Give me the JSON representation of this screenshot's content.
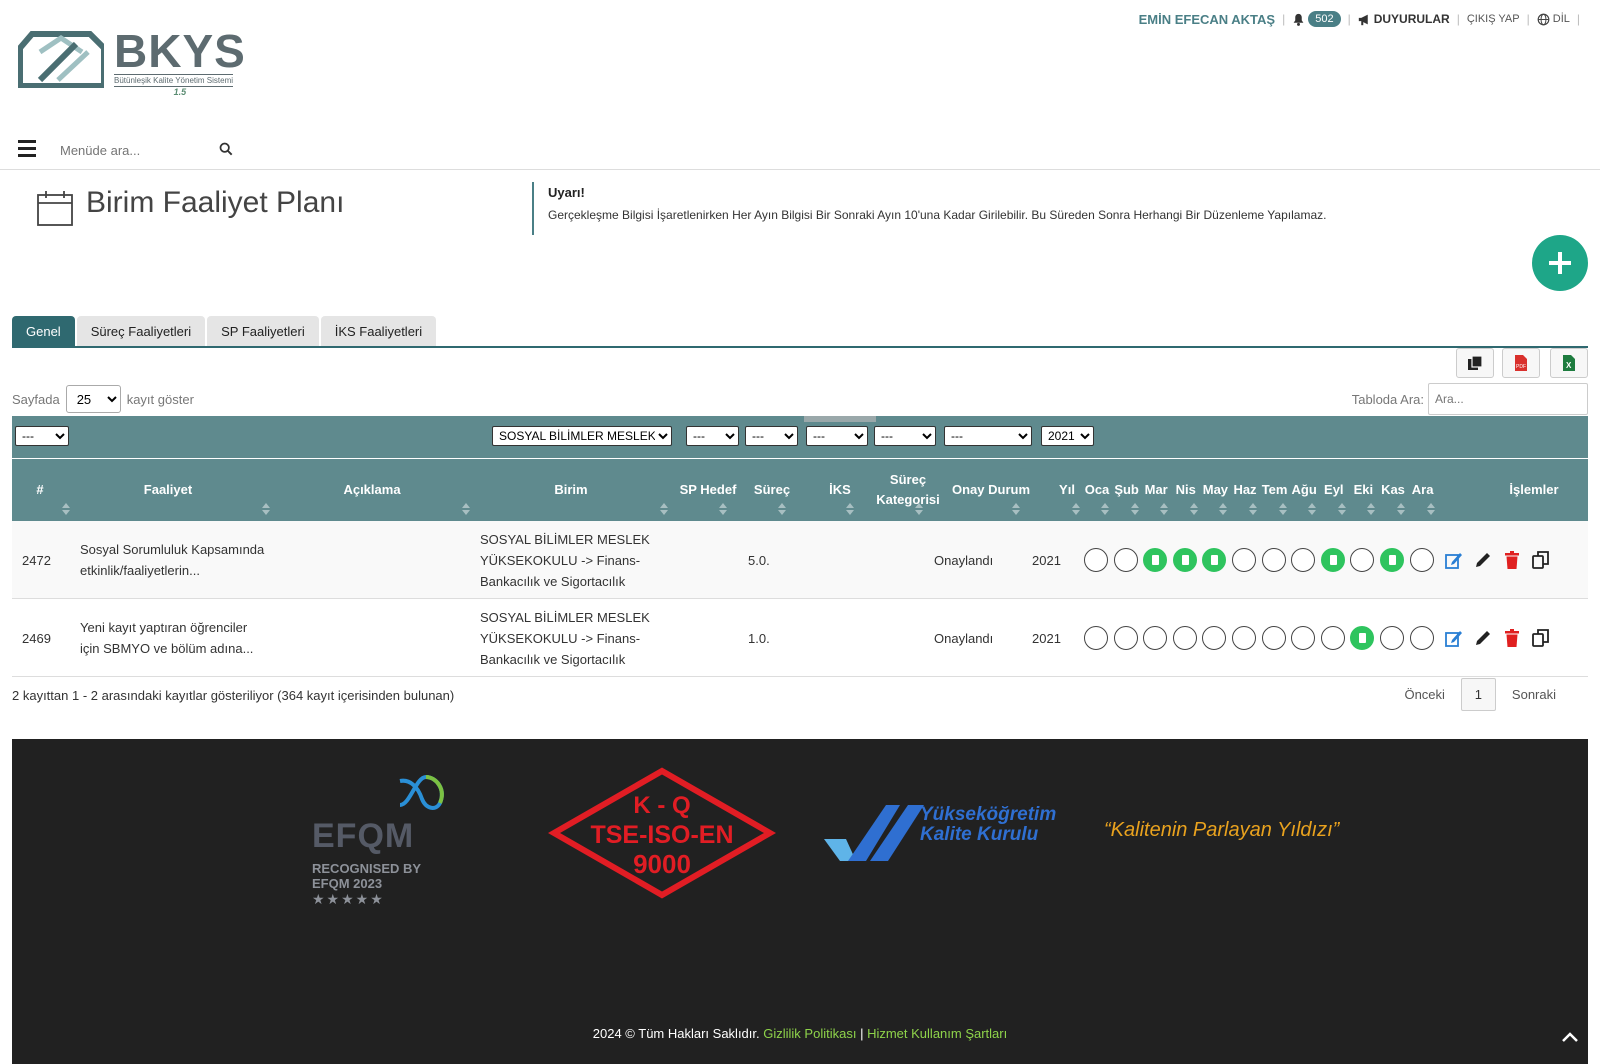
{
  "app": {
    "logo_word": "BKYS",
    "logo_subtitle": "Bütünleşik Kalite Yönetim Sistemi",
    "logo_version": "1.5"
  },
  "topbar": {
    "user_name": "EMİN EFECAN  AKTAŞ",
    "notification_count": "502",
    "announcements_label": "DUYURULAR",
    "logout_label": "ÇIKIŞ YAP",
    "language_label": "DİL",
    "separator": "|"
  },
  "menu": {
    "search_placeholder": "Menüde ara..."
  },
  "page": {
    "title": "Birim Faaliyet Planı",
    "warning_title": "Uyarı!",
    "warning_text": "Gerçekleşme Bilgisi İşaretlenirken Her Ayın Bilgisi Bir Sonraki Ayın 10'una Kadar Girilebilir. Bu Süreden Sonra Herhangi Bir Düzenleme Yapılamaz."
  },
  "tabs": [
    {
      "label": "Genel",
      "active": true
    },
    {
      "label": "Süreç Faaliyetleri",
      "active": false
    },
    {
      "label": "SP Faaliyetleri",
      "active": false
    },
    {
      "label": "İKS Faaliyetleri",
      "active": false
    }
  ],
  "export_buttons": [
    "copy-icon",
    "pdf-icon",
    "excel-icon"
  ],
  "length_control": {
    "prefix": "Sayfada",
    "value": "25",
    "suffix": "kayıt göster"
  },
  "table_search": {
    "label": "Tabloda Ara:",
    "placeholder": "Ara..."
  },
  "filters": {
    "id": "---",
    "birim": "SOSYAL BİLİMLER MESLEK YÜKSEKOKULU",
    "sp_hedef": "---",
    "surec": "---",
    "iks": "---",
    "surec_kategorisi": "---",
    "onay_durum": "---",
    "yil": "2021"
  },
  "columns": {
    "id": "#",
    "faaliyet": "Faaliyet",
    "aciklama": "Açıklama",
    "birim": "Birim",
    "sp_hedef": "SP Hedef",
    "surec": "Süreç",
    "iks": "İKS",
    "surec_kategorisi_1": "Süreç",
    "surec_kategorisi_2": "Kategorisi",
    "onay_durum": "Onay Durum",
    "yil": "Yıl",
    "months": [
      "Oca",
      "Şub",
      "Mar",
      "Nis",
      "May",
      "Haz",
      "Tem",
      "Ağu",
      "Eyl",
      "Eki",
      "Kas",
      "Ara"
    ],
    "islemler": "İşlemler"
  },
  "rows": [
    {
      "id": "2472",
      "faaliyet_1": "Sosyal Sorumluluk Kapsamında",
      "faaliyet_2": "etkinlik/faaliyetlerin...",
      "aciklama": "",
      "birim_1": "SOSYAL BİLİMLER MESLEK",
      "birim_2": "YÜKSEKOKULU -> Finans-",
      "birim_3": "Bankacılık ve Sigortacılık",
      "sp_hedef": "",
      "surec": "5.0.",
      "iks": "",
      "surec_kategorisi": "",
      "onay_durum": "Onaylandı",
      "yil": "2021",
      "months": [
        false,
        false,
        true,
        true,
        true,
        false,
        false,
        false,
        true,
        false,
        true,
        false
      ]
    },
    {
      "id": "2469",
      "faaliyet_1": "Yeni kayıt yaptıran öğrenciler",
      "faaliyet_2": "için SBMYO ve bölüm adına...",
      "aciklama": "",
      "birim_1": "SOSYAL BİLİMLER MESLEK",
      "birim_2": "YÜKSEKOKULU -> Finans-",
      "birim_3": "Bankacılık ve Sigortacılık",
      "sp_hedef": "",
      "surec": "1.0.",
      "iks": "",
      "surec_kategorisi": "",
      "onay_durum": "Onaylandı",
      "yil": "2021",
      "months": [
        false,
        false,
        false,
        false,
        false,
        false,
        false,
        false,
        false,
        true,
        false,
        false
      ]
    }
  ],
  "table_info": "2 kayıttan 1 - 2 arasındaki kayıtlar gösteriliyor (364 kayıt içerisinden bulunan)",
  "pagination": {
    "prev": "Önceki",
    "current": "1",
    "next": "Sonraki"
  },
  "footer": {
    "efqm_word": "EFQM",
    "efqm_recognised": "RECOGNISED BY",
    "efqm_year": "EFQM 2023",
    "efqm_stars": "★★★★★",
    "kq_line1": "K - Q",
    "kq_line2": "TSE-ISO-EN",
    "kq_line3": "9000",
    "yok_line1": "Yükseköğretim",
    "yok_line2": "Kalite Kurulu",
    "slogan": "“Kalitenin Parlayan Yıldızı”",
    "copyright": "2024 © Tüm Hakları Saklıdır.",
    "privacy": "Gizlilik Politikası",
    "separator": "|",
    "terms": "Hizmet Kullanım Şartları"
  },
  "colors": {
    "accent": "#2f6970",
    "table_header": "#5f8a8e",
    "month_done": "#2ec45e",
    "add_button": "#1ea688",
    "edit_icon": "#2a7fd4",
    "delete_icon": "#e02020",
    "footer_bg": "#212121",
    "footer_link": "#8ed34a",
    "slogan": "#e9a21e"
  }
}
